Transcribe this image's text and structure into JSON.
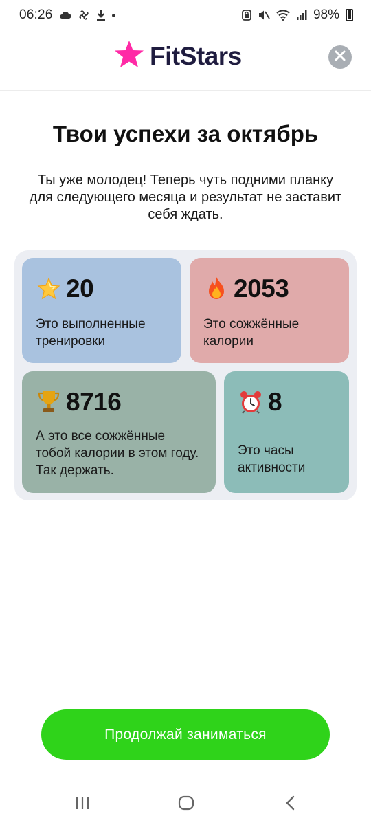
{
  "status_bar": {
    "time": "06:26",
    "battery": "98%"
  },
  "header": {
    "logo_text": "FitStars",
    "brand_color": "#ff2aa6",
    "close_icon": "close-icon"
  },
  "title": "Твои успехи за октябрь",
  "subtitle": "Ты уже молодец! Теперь чуть подними планку для следующего месяца и результат не заставит себя ждать.",
  "stats": {
    "workouts": {
      "icon": "star-icon",
      "value": "20",
      "text": "Это выполненные тренировки",
      "color": "#a9c2df"
    },
    "calories": {
      "icon": "fire-icon",
      "value": "2053",
      "text": "Это сожжённые калории",
      "color": "#e0aaaa"
    },
    "year_calories": {
      "icon": "trophy-icon",
      "value": "8716",
      "text": "А это все сожжённые тобой калории в этом году. Так держать.",
      "color": "#99b2a7"
    },
    "hours": {
      "icon": "alarm-clock-icon",
      "value": "8",
      "text": "Это часы активности",
      "color": "#8cbcb8"
    }
  },
  "cta": {
    "label": "Продолжай заниматься",
    "color": "#2fd31a"
  },
  "nav": {
    "recents": "recents-icon",
    "home": "home-icon",
    "back": "back-icon"
  }
}
